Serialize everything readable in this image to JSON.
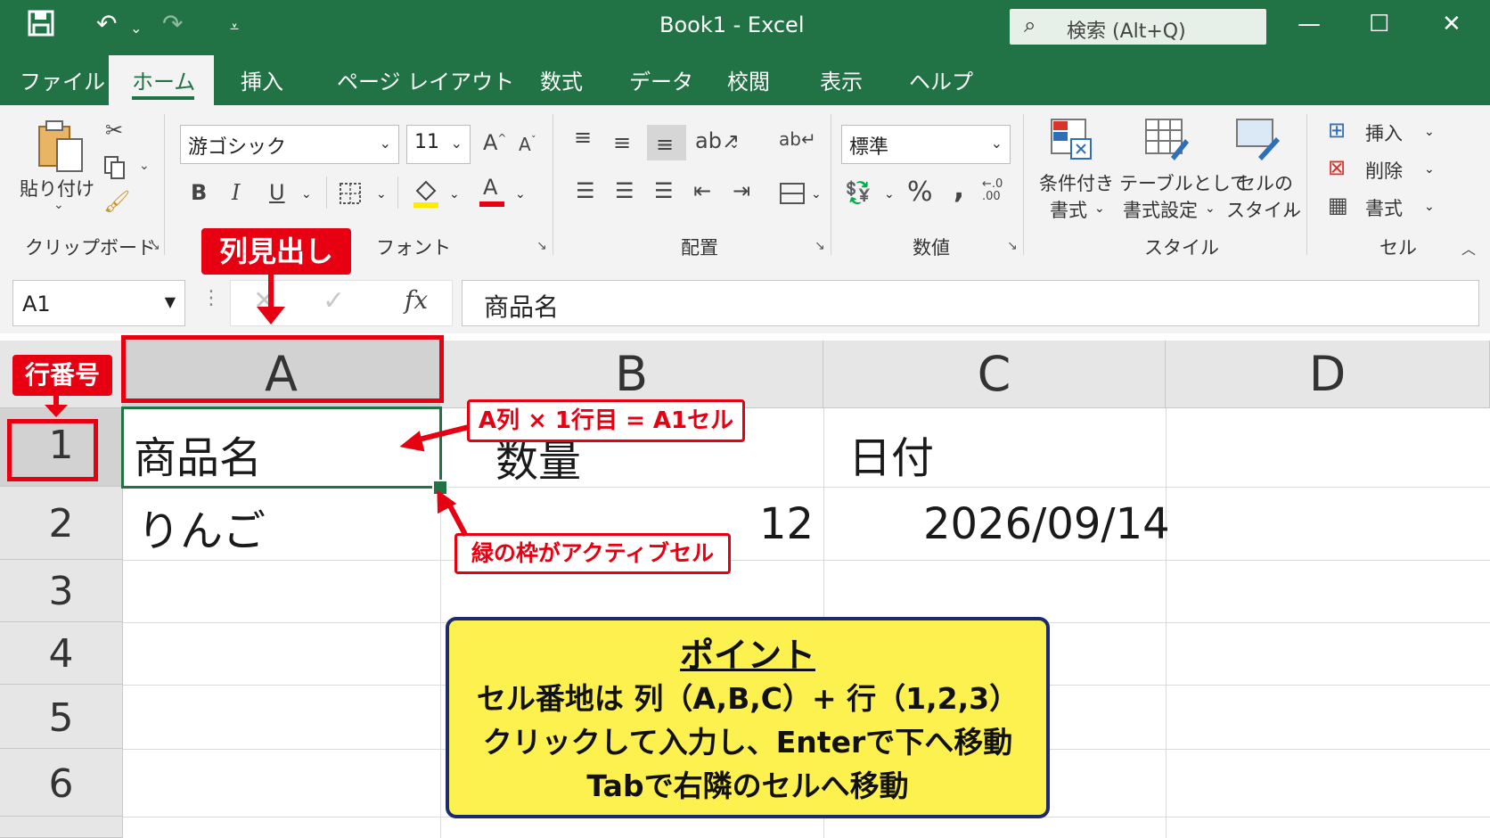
{
  "app": {
    "title": "Book1  -  Excel",
    "search_placeholder": "検索 (Alt+Q)",
    "accent_color": "#217346"
  },
  "quick_access": [
    "save-icon",
    "undo-icon",
    "redo-icon",
    "customize-icon"
  ],
  "menu": {
    "tabs": [
      "ファイル",
      "ホーム",
      "挿入",
      "ページ レイアウト",
      "数式",
      "データ",
      "校閲",
      "表示",
      "ヘルプ"
    ],
    "active": "ホーム"
  },
  "ribbon": {
    "clipboard": {
      "paste_label": "貼り付け",
      "group_label": "クリップボード"
    },
    "font": {
      "font_name": "游ゴシック",
      "font_size": "11",
      "group_label": "フォント",
      "bold": "B",
      "italic": "I",
      "underline": "U",
      "font_color_glyph": "A"
    },
    "alignment": {
      "group_label": "配置"
    },
    "number": {
      "format": "標準",
      "group_label": "数値",
      "percent": "%",
      "comma": ","
    },
    "styles": {
      "conditional": [
        "条件付き",
        "書式"
      ],
      "table": [
        "テーブルとして",
        "書式設定"
      ],
      "cell_styles": [
        "セルの",
        "スタイル"
      ],
      "group_label": "スタイル"
    },
    "cells": {
      "insert": "挿入",
      "delete": "削除",
      "format": "書式",
      "group_label": "セル"
    }
  },
  "formula_bar": {
    "name_box": "A1",
    "fx": "fx",
    "content": "商品名"
  },
  "grid": {
    "columns": [
      "A",
      "B",
      "C",
      "D"
    ],
    "rows": [
      "1",
      "2",
      "3",
      "4",
      "5",
      "6"
    ],
    "cells": {
      "A1": "商品名",
      "B1": "数量",
      "C1": "日付",
      "A2": "りんご",
      "B2": "12",
      "C2": "2026/09/14"
    }
  },
  "annotations": {
    "column_header_label": "列見出し",
    "row_number_label": "行番号",
    "a1_callout": "A列 × 1行目 = A1セル",
    "active_cell_callout": "緑の枠がアクティブセル",
    "point": {
      "title": "ポイント",
      "lines": [
        "セル番地は 列（A,B,C）+ 行（1,2,3）",
        "クリックして入力し、Enterで下へ移動",
        "Tabで右隣のセルへ移動"
      ]
    },
    "highlight_color": "#e60012"
  }
}
